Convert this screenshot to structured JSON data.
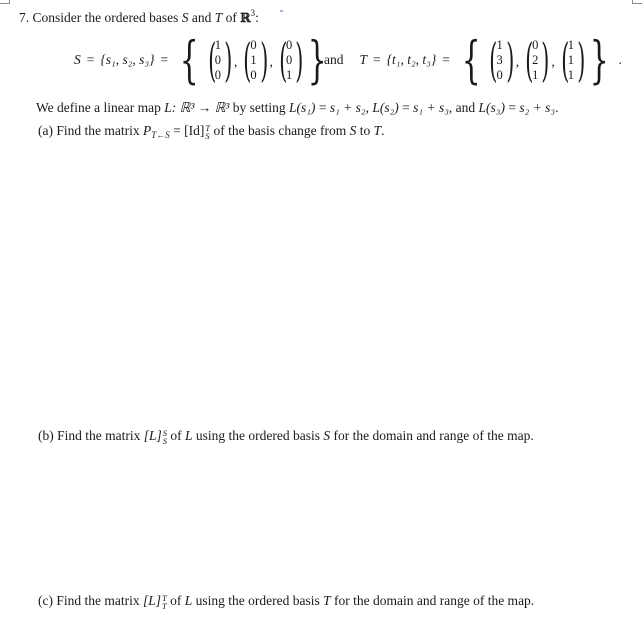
{
  "question": {
    "number": "7.",
    "intro": {
      "text_before": "Consider the ordered bases",
      "var_s": "S",
      "and_word": "and",
      "var_t": "T",
      "of_word": "of",
      "field": "ℝ",
      "dim": "3",
      "colon": ":"
    },
    "basis_s": {
      "name": "S",
      "set_notation": "{s₁, s₂, s₃}",
      "equals": "=",
      "vectors": [
        [
          "1",
          "0",
          "0"
        ],
        [
          "0",
          "1",
          "0"
        ],
        [
          "0",
          "0",
          "1"
        ]
      ]
    },
    "connector": "and",
    "basis_t": {
      "name": "T",
      "set_notation": "{t₁, t₂, t₃}",
      "equals": "=",
      "vectors": [
        [
          "1",
          "3",
          "0"
        ],
        [
          "0",
          "2",
          "1"
        ],
        [
          "1",
          "1",
          "1"
        ]
      ]
    },
    "definition": {
      "prefix": "We define a linear map",
      "map": "L",
      "signature": ": ℝ³ → ℝ³",
      "by_setting": "by setting",
      "rules": [
        {
          "lhs": "L(s₁)",
          "rhs": "s₁ + s₂",
          "sep": ","
        },
        {
          "lhs": "L(s₂)",
          "rhs": "s₁ + s₃",
          "sep": ", and"
        },
        {
          "lhs": "L(s₃)",
          "rhs": "s₂ + s₃",
          "sep": "."
        }
      ]
    },
    "parts": [
      {
        "label": "(a)",
        "text_before": "Find the matrix",
        "matrix": "P",
        "matrix_sub": "T←S",
        "equals": "=",
        "bracket": "[Id]",
        "sup": "T",
        "sub": "S",
        "text_after": "of the basis change from",
        "from": "S",
        "to_word": "to",
        "to": "T",
        "end": "."
      },
      {
        "label": "(b)",
        "text_before": "Find the matrix",
        "bracket": "[L]",
        "sup": "S",
        "sub": "S",
        "of_word": "of",
        "map": "L",
        "text_mid": "using the ordered basis",
        "basis": "S",
        "text_after": "for the domain and range of the map."
      },
      {
        "label": "(c)",
        "text_before": "Find the matrix",
        "bracket": "[L]",
        "sup": "T",
        "sub": "T",
        "of_word": "of",
        "map": "L",
        "text_mid": "using the ordered basis",
        "basis": "T",
        "text_after": "for the domain and range of the map."
      }
    ]
  }
}
